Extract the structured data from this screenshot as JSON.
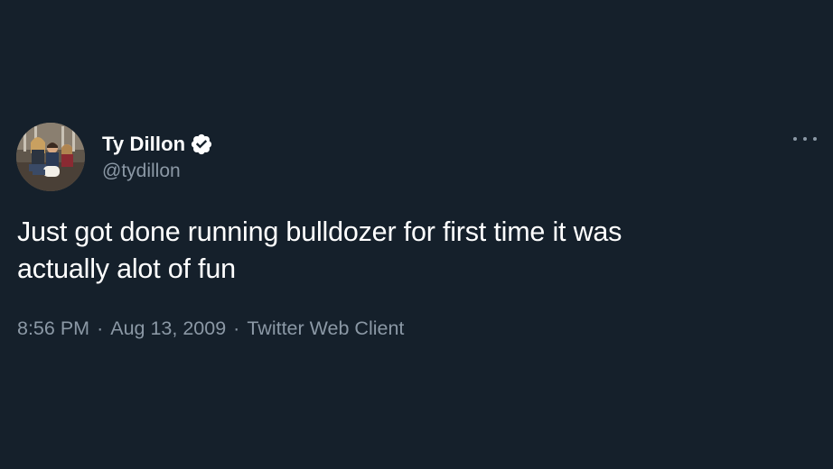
{
  "tweet": {
    "author": {
      "display_name": "Ty Dillon",
      "handle": "@tydillon",
      "verified": true,
      "verified_icon": "verified-badge-icon",
      "avatar": "profile-photo"
    },
    "more_icon": "more-horizontal-icon",
    "text_line1": "Just got done running bulldozer for first time it was",
    "text_line2": "actually alot of fun",
    "time": "8:56 PM",
    "date": "Aug 13, 2009",
    "separator": "·",
    "source": "Twitter Web Client"
  },
  "colors": {
    "background": "#15202b",
    "primary_text": "#ffffff",
    "secondary_text": "#8b98a5"
  }
}
